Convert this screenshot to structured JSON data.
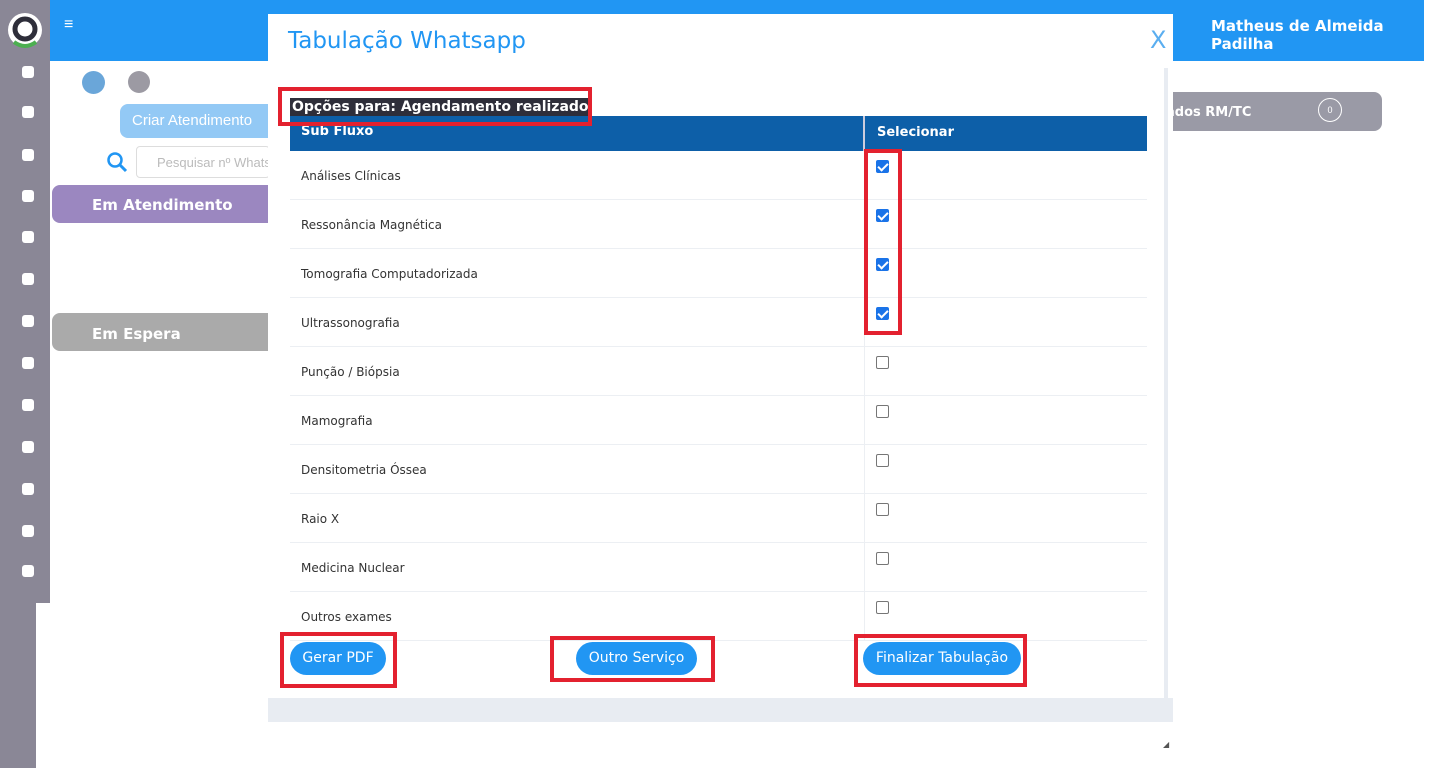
{
  "header": {
    "user_name": "Matheus de Almeida Padilha",
    "menu_icon": "hamburger-icon"
  },
  "sidebar": {
    "icons": [
      "chart-icon",
      "briefcase-icon",
      "whatsapp-icon",
      "grid-plus-icon",
      "refresh-icon",
      "phone-icon",
      "gear-icon",
      "printer-icon",
      "smile-icon",
      "calendar-icon",
      "palette-icon",
      "chat-icon",
      "video-icon"
    ]
  },
  "background": {
    "criar_label": "Criar Atendimento",
    "search_placeholder": "Pesquisar nº Whatsapp",
    "em_atendimento": "Em Atendimento",
    "em_espera": "Em Espera",
    "right_panel": "ados RM/TC",
    "right_count": "0"
  },
  "modal": {
    "title": "Tabulação Whatsapp",
    "close_label": "X",
    "options_title": "Opções para: Agendamento realizado",
    "columns": [
      "Sub Fluxo",
      "Selecionar"
    ],
    "rows": [
      {
        "label": "Análises Clínicas",
        "checked": true
      },
      {
        "label": "Ressonância Magnética",
        "checked": true
      },
      {
        "label": "Tomografia Computadorizada",
        "checked": true
      },
      {
        "label": "Ultrassonografia",
        "checked": true
      },
      {
        "label": "Punção / Biópsia",
        "checked": false
      },
      {
        "label": "Mamografia",
        "checked": false
      },
      {
        "label": "Densitometria Óssea",
        "checked": false
      },
      {
        "label": "Raio X",
        "checked": false
      },
      {
        "label": "Medicina Nuclear",
        "checked": false
      },
      {
        "label": "Outros exames",
        "checked": false
      }
    ],
    "buttons": {
      "pdf": "Gerar PDF",
      "other": "Outro Serviço",
      "finish": "Finalizar Tabulação"
    }
  },
  "colors": {
    "accent": "#2196f3",
    "table_header": "#0d5fa8",
    "highlight": "#e3212f"
  }
}
